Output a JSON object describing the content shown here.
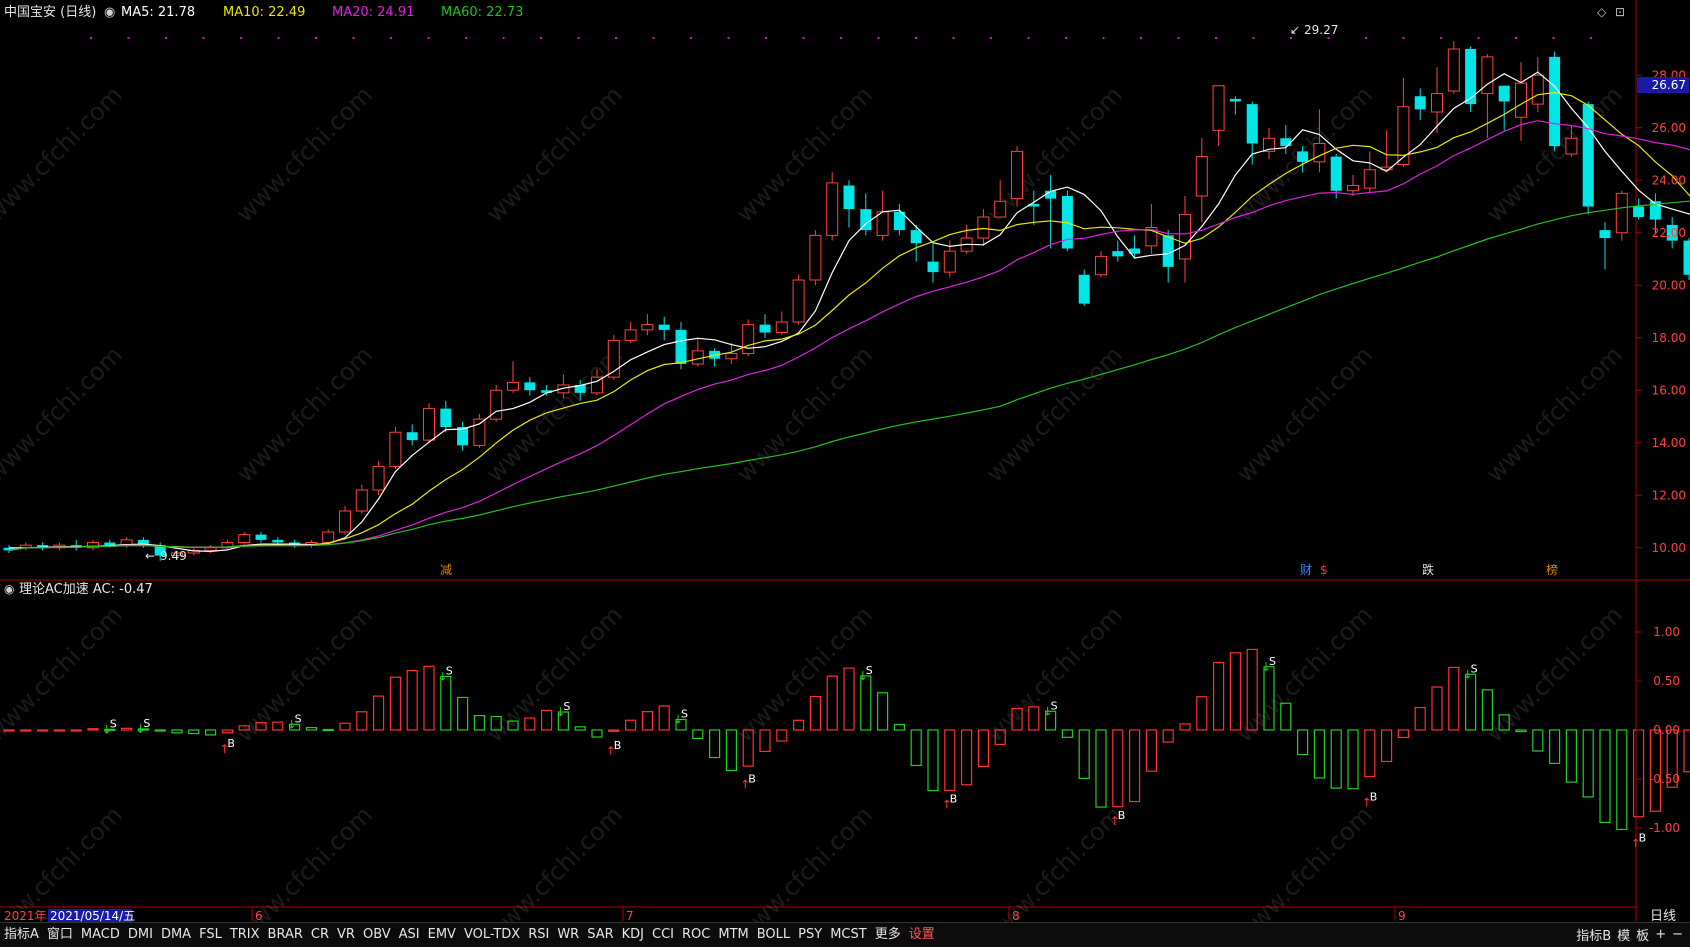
{
  "header": {
    "stock": "中国宝安 (日线)",
    "ma5_label": "MA5: 21.78",
    "ma10_label": "MA10: 22.49",
    "ma20_label": "MA20: 24.91",
    "ma60_label": "MA60: 22.73",
    "high_marker": "29.27",
    "low_marker": "9.49"
  },
  "colors": {
    "up": "#ff4040",
    "down": "#00e5e5",
    "ma5": "#ffffff",
    "ma10": "#e8e800",
    "ma20": "#e020e0",
    "ma60": "#20c020",
    "ac_up": "#ff3030",
    "ac_down": "#20d020",
    "axis": "#b00000"
  },
  "price_axis": {
    "ticks": [
      "28.00",
      "26.00",
      "24.00",
      "22.00",
      "20.00",
      "18.00",
      "16.00",
      "14.00",
      "12.00",
      "10.00"
    ],
    "current": "26.67"
  },
  "indicator": {
    "title": "理论AC加速 AC: -0.47",
    "ticks": [
      "1.00",
      "0.50",
      "0.00",
      "-0.50",
      "-1.00"
    ]
  },
  "events": {
    "e1": "减",
    "e2": "财",
    "e3": "$",
    "e4": "跌",
    "e5": "榜"
  },
  "time_axis": {
    "year": "2021年",
    "date": "2021/05/14/五",
    "m6": "6",
    "m7": "7",
    "m8": "8",
    "m9": "9",
    "period": "日线"
  },
  "watermark": "www.cfchi.com",
  "tabs": [
    "指标A",
    "窗口",
    "MACD",
    "DMI",
    "DMA",
    "FSL",
    "TRIX",
    "BRAR",
    "CR",
    "VR",
    "OBV",
    "ASI",
    "EMV",
    "VOL-TDX",
    "RSI",
    "WR",
    "SAR",
    "KDJ",
    "CCI",
    "ROC",
    "MTM",
    "BOLL",
    "PSY",
    "MCST",
    "更多",
    "设置"
  ],
  "right_tabs": [
    "指标B",
    "模",
    "板",
    "+",
    "−"
  ],
  "chart_data": {
    "type": "candlestick",
    "price_range": [
      9.0,
      29.8
    ],
    "candles": [
      [
        10.0,
        9.9,
        10.1,
        9.8
      ],
      [
        10.0,
        10.1,
        10.2,
        9.9
      ],
      [
        10.1,
        10.0,
        10.2,
        9.9
      ],
      [
        10.0,
        10.1,
        10.2,
        9.9
      ],
      [
        10.1,
        10.0,
        10.3,
        9.9
      ],
      [
        10.0,
        10.2,
        10.3,
        9.9
      ],
      [
        10.2,
        10.1,
        10.3,
        10.0
      ],
      [
        10.1,
        10.3,
        10.4,
        10.0
      ],
      [
        10.3,
        10.1,
        10.4,
        10.0
      ],
      [
        10.1,
        9.7,
        10.2,
        9.5
      ],
      [
        9.7,
        9.8,
        9.9,
        9.6
      ],
      [
        9.8,
        9.9,
        10.0,
        9.7
      ],
      [
        9.9,
        10.0,
        10.1,
        9.8
      ],
      [
        10.0,
        10.2,
        10.3,
        9.9
      ],
      [
        10.2,
        10.5,
        10.6,
        10.1
      ],
      [
        10.5,
        10.3,
        10.6,
        10.2
      ],
      [
        10.3,
        10.2,
        10.4,
        10.1
      ],
      [
        10.2,
        10.1,
        10.3,
        10.0
      ],
      [
        10.1,
        10.2,
        10.3,
        10.0
      ],
      [
        10.2,
        10.6,
        10.7,
        10.1
      ],
      [
        10.6,
        11.4,
        11.6,
        10.5
      ],
      [
        11.4,
        12.2,
        12.4,
        11.3
      ],
      [
        12.2,
        13.1,
        13.3,
        12.0
      ],
      [
        13.1,
        14.4,
        14.6,
        13.0
      ],
      [
        14.4,
        14.1,
        14.7,
        13.9
      ],
      [
        14.1,
        15.3,
        15.5,
        14.0
      ],
      [
        15.3,
        14.6,
        15.6,
        14.4
      ],
      [
        14.6,
        13.9,
        14.8,
        13.7
      ],
      [
        13.9,
        14.9,
        15.1,
        13.8
      ],
      [
        14.9,
        16.0,
        16.2,
        14.8
      ],
      [
        16.0,
        16.3,
        17.1,
        15.9
      ],
      [
        16.3,
        16.0,
        16.5,
        15.8
      ],
      [
        16.0,
        15.9,
        16.2,
        15.8
      ],
      [
        15.9,
        16.2,
        16.6,
        15.7
      ],
      [
        16.2,
        15.9,
        16.4,
        15.6
      ],
      [
        15.9,
        16.5,
        16.8,
        15.8
      ],
      [
        16.5,
        17.9,
        18.1,
        16.4
      ],
      [
        17.9,
        18.3,
        18.6,
        17.8
      ],
      [
        18.3,
        18.5,
        18.9,
        18.1
      ],
      [
        18.5,
        18.3,
        18.8,
        17.9
      ],
      [
        18.3,
        17.0,
        18.6,
        16.8
      ],
      [
        17.0,
        17.5,
        18.0,
        16.9
      ],
      [
        17.5,
        17.2,
        17.6,
        16.9
      ],
      [
        17.2,
        17.4,
        17.8,
        17.0
      ],
      [
        17.4,
        18.5,
        18.7,
        17.3
      ],
      [
        18.5,
        18.2,
        18.9,
        18.0
      ],
      [
        18.2,
        18.6,
        19.0,
        18.1
      ],
      [
        18.6,
        20.2,
        20.4,
        18.5
      ],
      [
        20.2,
        21.9,
        22.1,
        20.0
      ],
      [
        21.9,
        23.9,
        24.3,
        21.7
      ],
      [
        23.8,
        22.9,
        24.0,
        22.2
      ],
      [
        22.9,
        22.1,
        23.5,
        21.9
      ],
      [
        21.9,
        22.8,
        23.6,
        21.7
      ],
      [
        22.8,
        22.1,
        23.1,
        21.9
      ],
      [
        22.1,
        21.6,
        22.3,
        20.9
      ],
      [
        20.9,
        20.5,
        21.6,
        20.1
      ],
      [
        20.5,
        21.3,
        21.7,
        20.3
      ],
      [
        21.3,
        21.8,
        22.3,
        21.2
      ],
      [
        21.8,
        22.6,
        22.9,
        21.5
      ],
      [
        22.6,
        23.2,
        24.0,
        22.6
      ],
      [
        23.3,
        25.1,
        25.3,
        23.0
      ],
      [
        23.1,
        23.0,
        23.6,
        22.3
      ],
      [
        23.6,
        23.3,
        24.2,
        21.4
      ],
      [
        23.4,
        21.4,
        23.6,
        21.3
      ],
      [
        20.4,
        19.3,
        20.6,
        19.2
      ],
      [
        20.4,
        21.1,
        21.3,
        20.3
      ],
      [
        21.3,
        21.1,
        21.7,
        20.9
      ],
      [
        21.4,
        21.2,
        21.9,
        21.0
      ],
      [
        21.5,
        22.2,
        23.1,
        21.2
      ],
      [
        21.9,
        20.7,
        22.1,
        20.1
      ],
      [
        21.0,
        22.7,
        23.4,
        20.1
      ],
      [
        23.4,
        24.9,
        25.6,
        22.4
      ],
      [
        25.9,
        27.6,
        27.6,
        25.3
      ],
      [
        27.1,
        27.0,
        27.2,
        26.5
      ],
      [
        26.9,
        25.4,
        27.0,
        24.6
      ],
      [
        25.1,
        25.6,
        26.0,
        24.8
      ],
      [
        25.6,
        25.3,
        26.1,
        25.0
      ],
      [
        25.1,
        24.7,
        25.3,
        24.3
      ],
      [
        24.7,
        25.4,
        26.7,
        24.3
      ],
      [
        24.9,
        23.6,
        25.0,
        23.3
      ],
      [
        23.6,
        23.8,
        24.2,
        23.4
      ],
      [
        23.7,
        24.4,
        25.1,
        23.5
      ],
      [
        24.4,
        24.5,
        25.9,
        24.3
      ],
      [
        24.6,
        26.8,
        27.9,
        24.5
      ],
      [
        27.2,
        26.7,
        27.5,
        26.3
      ],
      [
        26.6,
        27.3,
        28.3,
        25.8
      ],
      [
        27.4,
        29.0,
        29.3,
        27.3
      ],
      [
        29.0,
        26.9,
        29.1,
        26.6
      ],
      [
        27.3,
        28.7,
        28.8,
        25.6
      ],
      [
        27.6,
        27.0,
        27.6,
        25.9
      ],
      [
        26.4,
        27.7,
        28.5,
        25.5
      ],
      [
        26.9,
        28.0,
        28.7,
        26.6
      ],
      [
        28.7,
        25.3,
        28.9,
        25.1
      ],
      [
        25.0,
        25.6,
        26.1,
        24.9
      ],
      [
        26.9,
        23.0,
        27.0,
        22.7
      ],
      [
        22.1,
        21.8,
        22.4,
        20.6
      ],
      [
        22.0,
        23.5,
        23.6,
        21.7
      ],
      [
        23.0,
        22.6,
        23.3,
        22.5
      ],
      [
        23.2,
        22.5,
        23.5,
        22.0
      ],
      [
        22.3,
        21.7,
        22.6,
        21.4
      ],
      [
        21.7,
        20.4,
        21.8,
        20.2
      ],
      [
        20.4,
        22.3,
        22.3,
        20.1
      ],
      [
        22.1,
        21.7,
        23.4,
        21.3
      ]
    ],
    "ma5": [
      10.0,
      10.0,
      10.02,
      10.04,
      10.04,
      10.06,
      10.08,
      10.12,
      10.14,
      10.08,
      9.98,
      9.88,
      9.86,
      9.92,
      10.08,
      10.14,
      10.14,
      10.14,
      10.12,
      10.16,
      10.38,
      10.98,
      11.86,
      12.9,
      13.52,
      14.02,
      14.5,
      14.52,
      14.72,
      15.2,
      15.3,
      15.54,
      15.9,
      16.08,
      16.18,
      16.34,
      16.72,
      17.16,
      17.46,
      17.74,
      17.88,
      17.98,
      17.92,
      17.74,
      17.6,
      17.66,
      17.86,
      18.18,
      19.02,
      20.48,
      21.7,
      22.34,
      22.8,
      22.86,
      22.22,
      21.62,
      21.48,
      21.56,
      21.54,
      21.92,
      22.76,
      23.16,
      23.58,
      23.74,
      23.46,
      22.84,
      21.84,
      21.04,
      21.14,
      21.2,
      21.52,
      22.24,
      23.1,
      24.2,
      25.0,
      25.18,
      25.24,
      25.92,
      25.74,
      25.18,
      24.74,
      24.66,
      24.34,
      24.88,
      25.36,
      26.06,
      26.74,
      27.12,
      27.66,
      28.06,
      27.72,
      28.12,
      27.58,
      26.74,
      26.0,
      25.1,
      24.34,
      23.62,
      23.1,
      22.9,
      22.72,
      22.74,
      22.58,
      22.32
    ]
  }
}
